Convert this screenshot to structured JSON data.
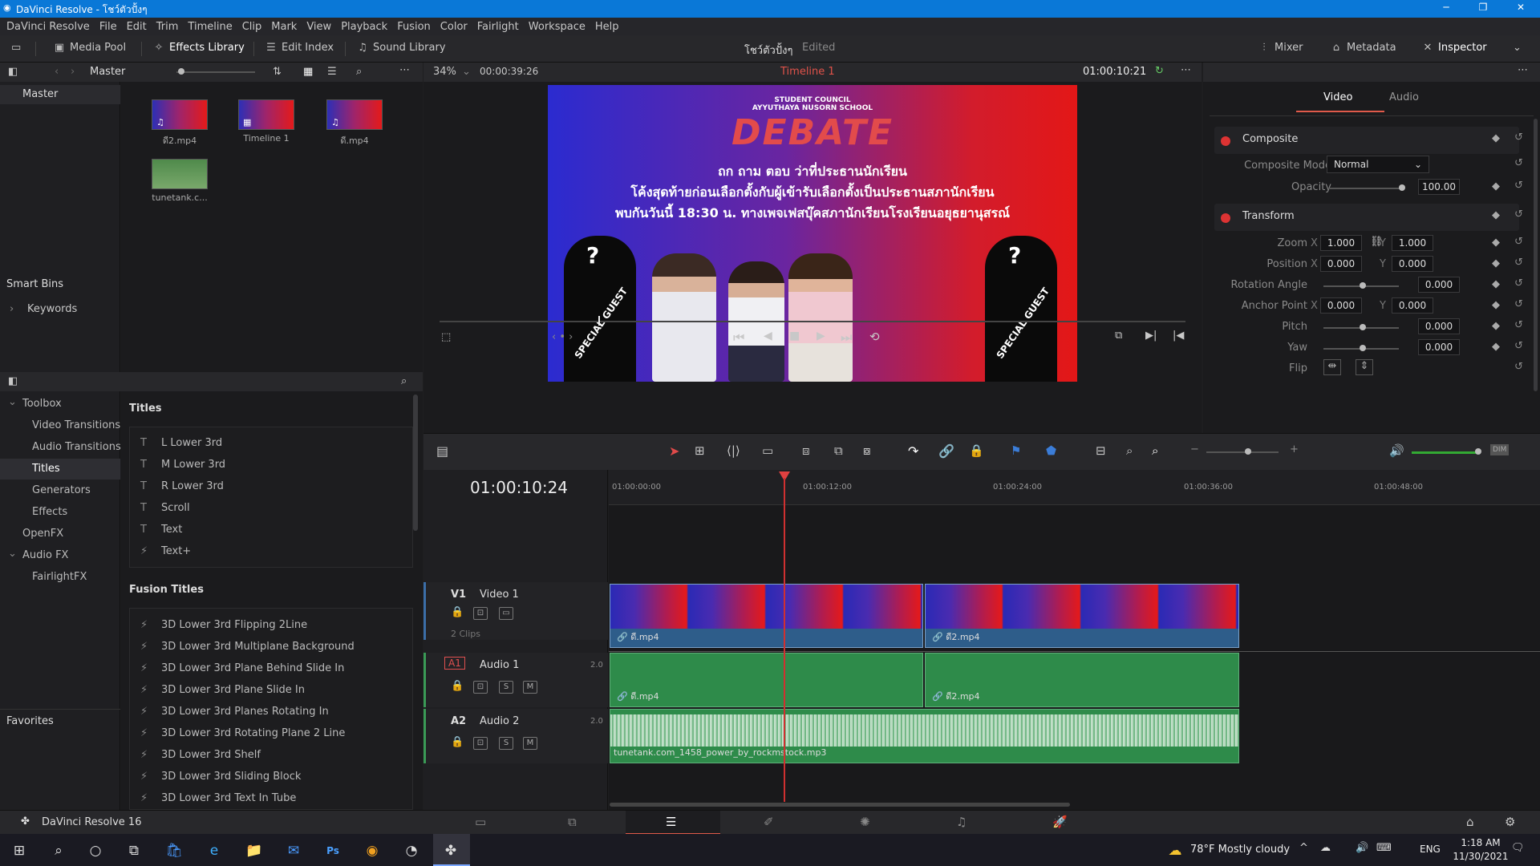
{
  "window": {
    "title": "DaVinci Resolve - โชว์ตัวปั้งๆ"
  },
  "menu": [
    "DaVinci Resolve",
    "File",
    "Edit",
    "Trim",
    "Timeline",
    "Clip",
    "Mark",
    "View",
    "Playback",
    "Fusion",
    "Color",
    "Fairlight",
    "Workspace",
    "Help"
  ],
  "toolbar": {
    "media_pool": "Media Pool",
    "effects_library": "Effects Library",
    "edit_index": "Edit Index",
    "sound_library": "Sound Library",
    "project_name": "โชว์ตัวปั้งๆ",
    "project_status": "Edited",
    "mixer": "Mixer",
    "metadata": "Metadata",
    "inspector": "Inspector"
  },
  "media_pool": {
    "bin_label": "Master",
    "root": "Master",
    "items": [
      {
        "name": "ดี2.mp4",
        "kind": "video"
      },
      {
        "name": "Timeline 1",
        "kind": "timeline"
      },
      {
        "name": "ดี.mp4",
        "kind": "video"
      },
      {
        "name": "tunetank.c...",
        "kind": "audio"
      }
    ],
    "smart_bins": "Smart Bins",
    "keywords": "Keywords",
    "favorites": "Favorites"
  },
  "effects": {
    "toolbox": "Toolbox",
    "video_transitions": "Video Transitions",
    "audio_transitions": "Audio Transitions",
    "titles": "Titles",
    "generators": "Generators",
    "effects": "Effects",
    "openfx": "OpenFX",
    "audio_fx": "Audio FX",
    "fairlightfx": "FairlightFX",
    "titles_header": "Titles",
    "titles_list": [
      "L Lower 3rd",
      "M Lower 3rd",
      "R Lower 3rd",
      "Scroll",
      "Text",
      "Text+"
    ],
    "fusion_header": "Fusion Titles",
    "fusion_list": [
      "3D Lower 3rd Flipping 2Line",
      "3D Lower 3rd Multiplane Background",
      "3D Lower 3rd Plane Behind Slide In",
      "3D Lower 3rd Plane Slide In",
      "3D Lower 3rd Planes Rotating In",
      "3D Lower 3rd Rotating Plane 2 Line",
      "3D Lower 3rd Shelf",
      "3D Lower 3rd Sliding Block",
      "3D Lower 3rd Text In Tube"
    ]
  },
  "viewer": {
    "zoom": "34%",
    "duration": "00:00:39:26",
    "timeline_name": "Timeline 1",
    "timecode": "01:00:10:21",
    "frame": {
      "council": "STUDENT COUNCIL",
      "school": "AYYUTHAYA NUSORN SCHOOL",
      "debate": "DEBATE",
      "line1": "ถก ถาม ตอบ ว่าที่ประธานนักเรียน",
      "line2": "โค้งสุดท้ายก่อนเลือกตั้งกับผู้เข้ารับเลือกตั้งเป็นประธานสภานักเรียน",
      "line3": "พบกันวันนี้ 18:30 น. ทางเพจเฟสบุ๊คสภานักเรียนโรงเรียนอยุธยานุสรณ์",
      "guest": "SPECIAL GUEST",
      "q": "?"
    }
  },
  "inspector": {
    "tab_video": "Video",
    "tab_audio": "Audio",
    "composite": "Composite",
    "composite_mode_label": "Composite Mode",
    "composite_mode": "Normal",
    "opacity_label": "Opacity",
    "opacity": "100.00",
    "opacity_level": 1.0,
    "transform": "Transform",
    "zoom_label": "Zoom",
    "zoom_x": "1.000",
    "zoom_y": "1.000",
    "position_label": "Position",
    "pos_x": "0.000",
    "pos_y": "0.000",
    "rotation_label": "Rotation Angle",
    "rotation": "0.000",
    "anchor_label": "Anchor Point",
    "anchor_x": "0.000",
    "anchor_y": "0.000",
    "pitch_label": "Pitch",
    "pitch": "0.000",
    "yaw_label": "Yaw",
    "yaw": "0.000",
    "flip_label": "Flip",
    "x": "X",
    "y": "Y"
  },
  "timeline": {
    "timecode": "01:00:10:24",
    "ruler": [
      "01:00:00:00",
      "01:00:12:00",
      "01:00:24:00",
      "01:00:36:00",
      "01:00:48:00"
    ],
    "v1": {
      "id": "V1",
      "name": "Video 1",
      "count": "2 Clips"
    },
    "a1": {
      "id": "A1",
      "name": "Audio 1",
      "ch": "2.0"
    },
    "a2": {
      "id": "A2",
      "name": "Audio 2",
      "ch": "2.0"
    },
    "clips": {
      "v_a": "ดี.mp4",
      "v_b": "ดี2.mp4",
      "a_a": "ดี.mp4",
      "a_b": "ดี2.mp4",
      "music": "tunetank.com_1458_power_by_rockmstock.mp3"
    },
    "s": "S",
    "m": "M"
  },
  "footer": {
    "app": "DaVinci Resolve 16"
  },
  "taskbar": {
    "weather": "78°F  Mostly cloudy",
    "lang": "ENG",
    "time": "1:18 AM",
    "date": "11/30/2021"
  }
}
